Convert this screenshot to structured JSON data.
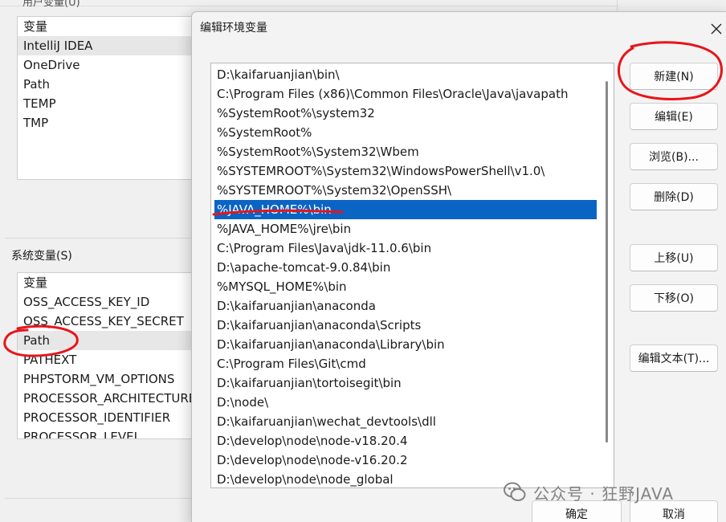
{
  "background_window": {
    "user_vars_group_label": "用户变量(U)",
    "user_vars": {
      "header": "变量",
      "rows": [
        "IntelliJ IDEA",
        "OneDrive",
        "Path",
        "TEMP",
        "TMP"
      ],
      "selected_index": 0
    },
    "system_vars_group_label": "系统变量(S)",
    "system_vars": {
      "header": "变量",
      "rows": [
        "OSS_ACCESS_KEY_ID",
        "OSS_ACCESS_KEY_SECRET",
        "Path",
        "PATHEXT",
        "PHPSTORM_VM_OPTIONS",
        "PROCESSOR_ARCHITECTURE",
        "PROCESSOR_IDENTIFIER",
        "PROCESSOR_LEVEL"
      ],
      "selected_index": 2
    }
  },
  "dialog": {
    "title": "编辑环境变量",
    "close_icon": "close-icon",
    "entries": [
      "D:\\kaifaruanjian\\bin\\",
      "C:\\Program Files (x86)\\Common Files\\Oracle\\Java\\javapath",
      "%SystemRoot%\\system32",
      "%SystemRoot%",
      "%SystemRoot%\\System32\\Wbem",
      "%SYSTEMROOT%\\System32\\WindowsPowerShell\\v1.0\\",
      "%SYSTEMROOT%\\System32\\OpenSSH\\",
      "%JAVA_HOME%\\bin",
      "%JAVA_HOME%\\jre\\bin",
      "C:\\Program Files\\Java\\jdk-11.0.6\\bin",
      "D:\\apache-tomcat-9.0.84\\bin",
      "%MYSQL_HOME%\\bin",
      "D:\\kaifaruanjian\\anaconda",
      "D:\\kaifaruanjian\\anaconda\\Scripts",
      "D:\\kaifaruanjian\\anaconda\\Library\\bin",
      "C:\\Program Files\\Git\\cmd",
      "D:\\kaifaruanjian\\tortoisegit\\bin",
      "D:\\node\\",
      "D:\\kaifaruanjian\\wechat_devtools\\dll",
      "D:\\develop\\node\\node-v18.20.4",
      "D:\\develop\\node\\node-v16.20.2",
      "D:\\develop\\node\\node_global"
    ],
    "selected_index": 7,
    "buttons": {
      "new": "新建(N)",
      "edit": "编辑(E)",
      "browse": "浏览(B)...",
      "delete": "删除(D)",
      "move_up": "上移(U)",
      "move_down": "下移(O)",
      "edit_text": "编辑文本(T)...",
      "ok": "确定",
      "cancel": "取消"
    }
  },
  "watermark": {
    "text": "公众号 · 狂野JAVA",
    "icon": "wechat-icon"
  },
  "colors": {
    "selection": "#0a64c4",
    "annotation": "#e8141b"
  }
}
